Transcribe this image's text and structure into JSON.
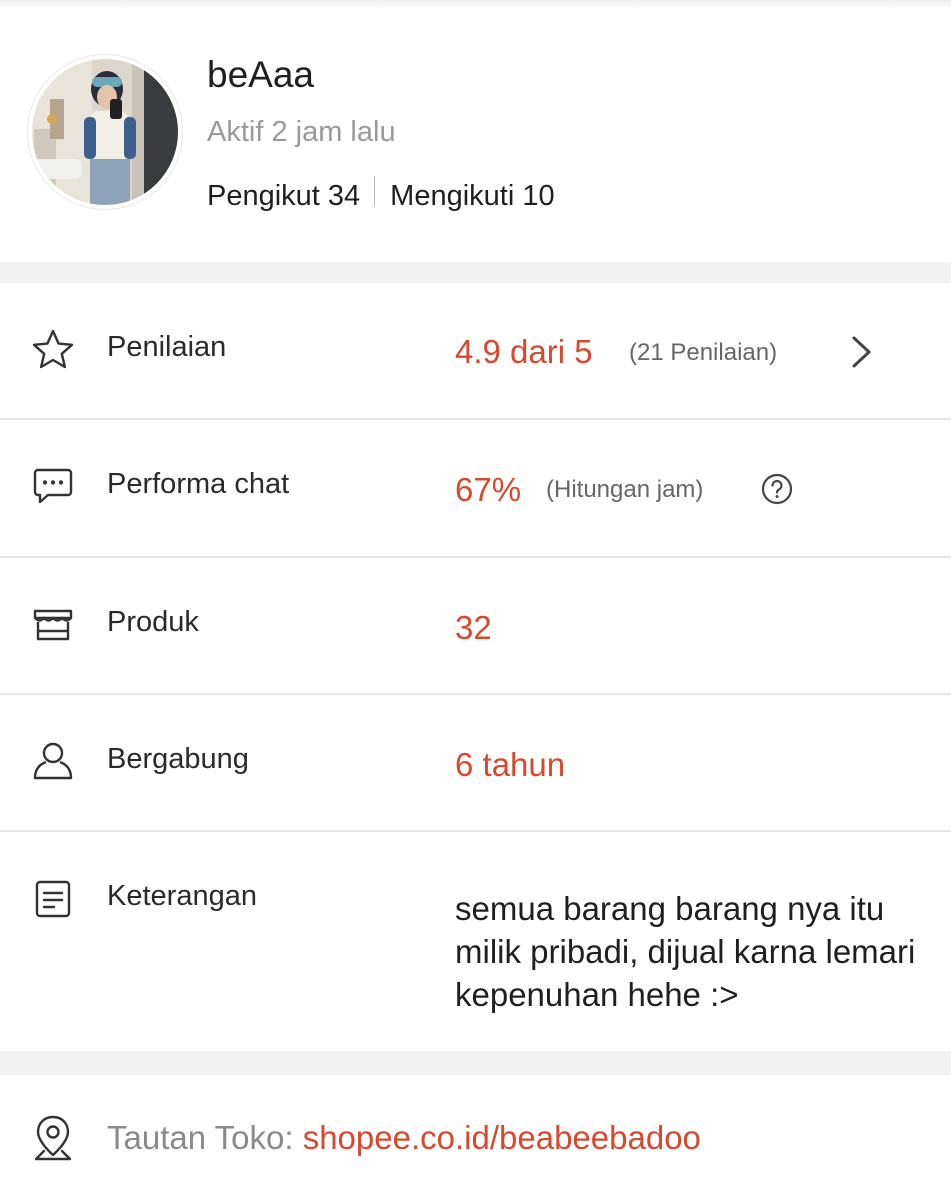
{
  "profile": {
    "username": "beAaa",
    "active_status": "Aktif 2 jam lalu",
    "followers_label": "Pengikut 34",
    "following_label": "Mengikuti 10"
  },
  "stats": {
    "rating": {
      "icon": "star-icon",
      "label": "Penilaian",
      "value": "4.9 dari 5",
      "sub": "(21 Penilaian)"
    },
    "chat": {
      "icon": "chat-bubble-icon",
      "label": "Performa chat",
      "value": "67%",
      "sub": "(Hitungan jam)"
    },
    "products": {
      "icon": "shop-icon",
      "label": "Produk",
      "value": "32"
    },
    "joined": {
      "icon": "user-icon",
      "label": "Bergabung",
      "value": "6 tahun"
    },
    "description": {
      "icon": "document-icon",
      "label": "Keterangan",
      "value": "semua barang barang nya itu milik pribadi, dijual karna lemari kepenuhan hehe :>"
    }
  },
  "shop_link": {
    "icon": "location-pin-icon",
    "label": "Tautan Toko: ",
    "url": "shopee.co.id/beabeebadoo"
  },
  "colors": {
    "accent": "#d9482b",
    "muted": "#9a9a9a",
    "background": "#f2f2f2"
  }
}
